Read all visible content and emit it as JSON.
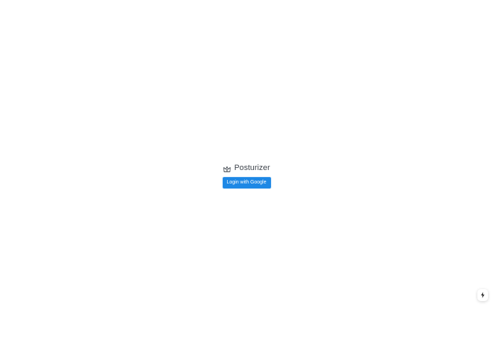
{
  "app": {
    "name": "Posturizer",
    "icon": "crown-icon"
  },
  "auth": {
    "login_label": "Login with Google"
  },
  "floating_action": {
    "icon": "lightning-bolt-icon"
  },
  "colors": {
    "primary_button": "#1e88e5",
    "text": "#3d434b",
    "background": "#ffffff"
  }
}
